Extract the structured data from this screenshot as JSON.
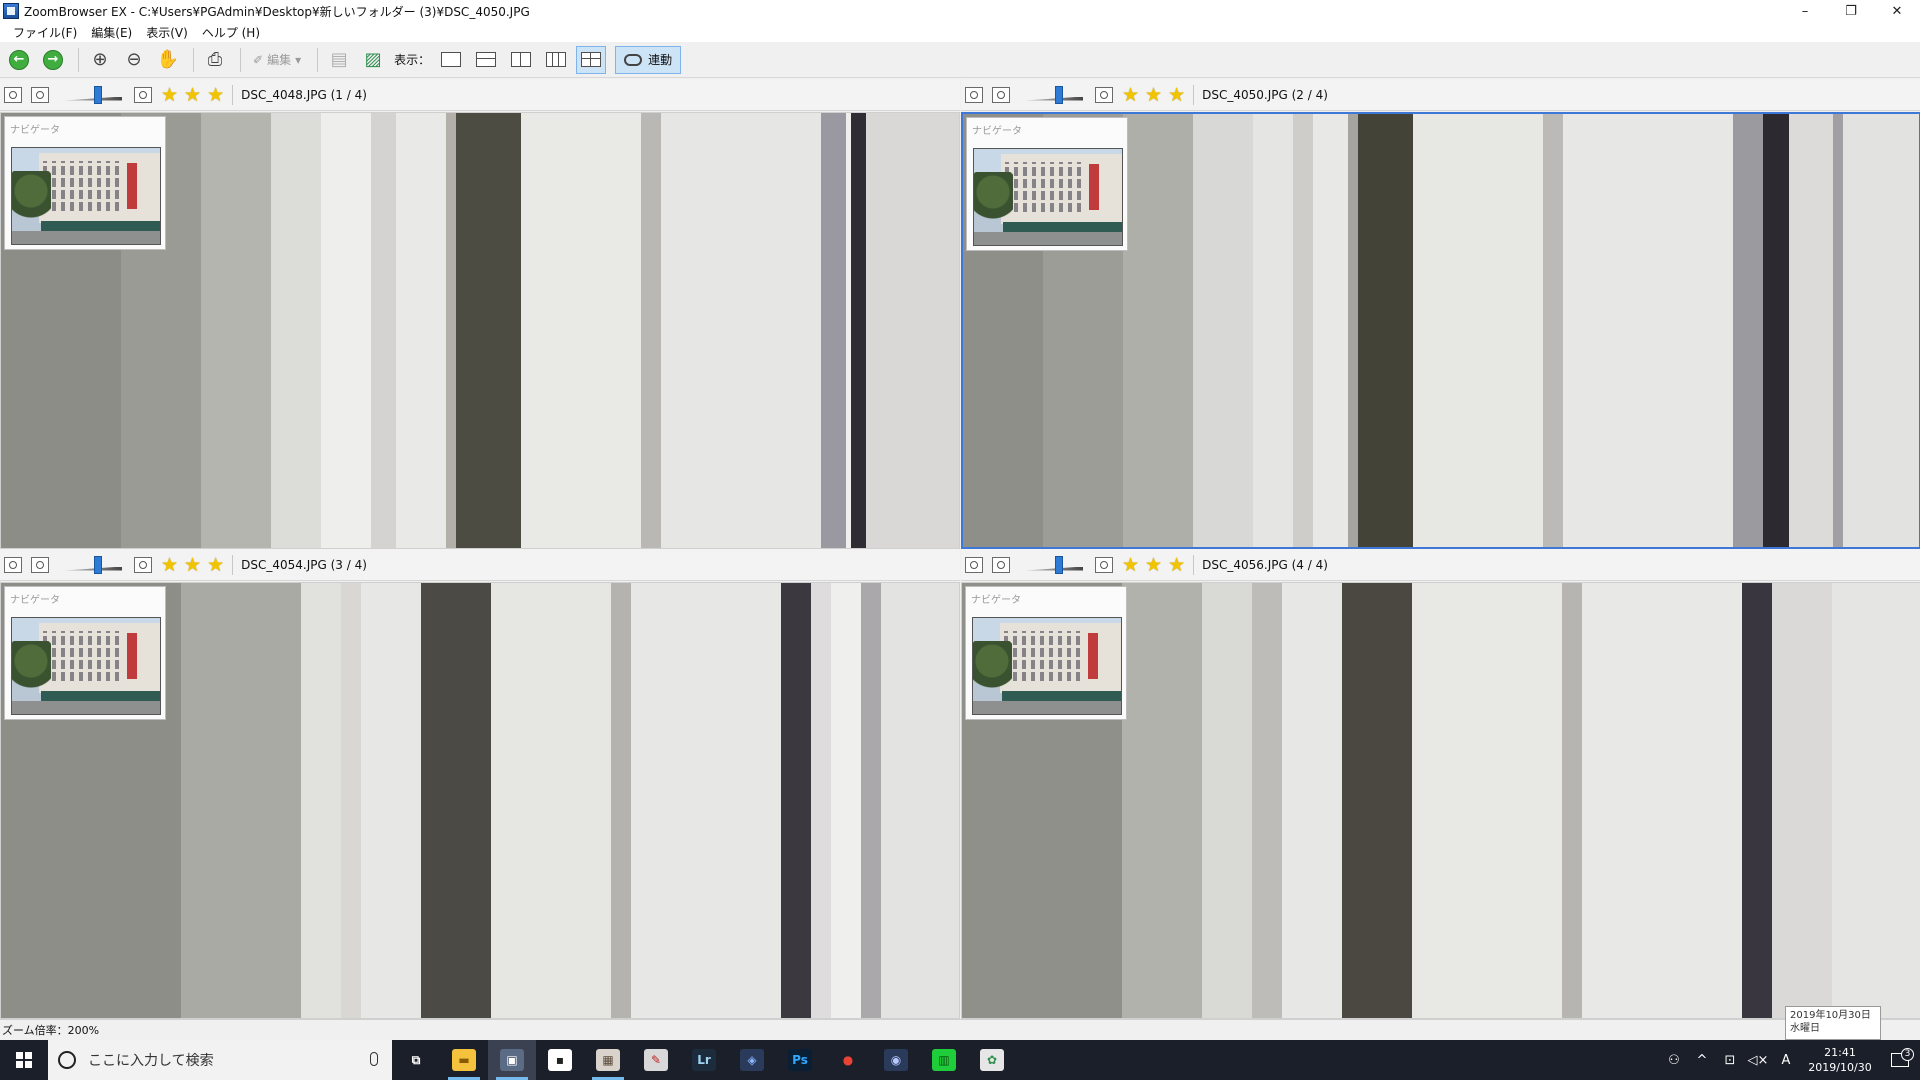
{
  "window": {
    "title": "ZoomBrowser EX - C:¥Users¥PGAdmin¥Desktop¥新しいフォルダー (3)¥DSC_4050.JPG",
    "controls": {
      "minimize": "–",
      "restore": "❐",
      "close": "✕"
    }
  },
  "menu": {
    "items": [
      "ファイル(F)",
      "編集(E)",
      "表示(V)",
      "ヘルプ (H)"
    ]
  },
  "toolbar": {
    "edit_label": "編集",
    "view_label": "表示：",
    "sync_label": "連動",
    "icons": [
      "back-arrow-icon",
      "forward-arrow-icon",
      "zoom-in-icon",
      "zoom-out-icon",
      "hand-icon",
      "print-icon"
    ]
  },
  "panels": [
    {
      "filename": "DSC_4048.JPG (1 / 4)",
      "navigator_label": "ナビゲータ",
      "selected": false,
      "zoom_level": 0.6
    },
    {
      "filename": "DSC_4050.JPG (2 / 4)",
      "navigator_label": "ナビゲータ",
      "selected": true,
      "zoom_level": 0.6
    },
    {
      "filename": "DSC_4054.JPG (3 / 4)",
      "navigator_label": "ナビゲータ",
      "selected": false,
      "zoom_level": 0.6
    },
    {
      "filename": "DSC_4056.JPG (4 / 4)",
      "navigator_label": "ナビゲータ",
      "selected": false,
      "zoom_level": 0.6
    }
  ],
  "status": {
    "zoom_text": "ズーム倍率：200%"
  },
  "tooltip": {
    "date": "2019年10月30日",
    "weekday": "水曜日"
  },
  "taskbar": {
    "search_placeholder": "ここに入力して検索",
    "apps": [
      {
        "name": "task-view",
        "label": "⧉",
        "bg": "transparent",
        "fg": "#ffffff"
      },
      {
        "name": "file-explorer",
        "label": "▬",
        "bg": "#f4c23d",
        "fg": "#8a5b00"
      },
      {
        "name": "zoombrowser",
        "label": "▣",
        "bg": "#5a6b86",
        "fg": "#ffffff"
      },
      {
        "name": "store",
        "label": "▪",
        "bg": "#ffffff",
        "fg": "#222222"
      },
      {
        "name": "image-viewer",
        "label": "▦",
        "bg": "#d9d3cc",
        "fg": "#5a4a3a"
      },
      {
        "name": "pdf-reader",
        "label": "✎",
        "bg": "#d8d8d8",
        "fg": "#c02020"
      },
      {
        "name": "lightroom",
        "label": "Lr",
        "bg": "#1c2c3c",
        "fg": "#9fd3f2"
      },
      {
        "name": "camera-tool",
        "label": "◈",
        "bg": "#2a3a5a",
        "fg": "#8ab4ff"
      },
      {
        "name": "photoshop",
        "label": "Ps",
        "bg": "#0a1f33",
        "fg": "#31a8ff"
      },
      {
        "name": "chrome",
        "label": "●",
        "bg": "transparent",
        "fg": "#e84335"
      },
      {
        "name": "capture-tool",
        "label": "◉",
        "bg": "#2a3a5a",
        "fg": "#b8c8ff"
      },
      {
        "name": "green-app",
        "label": "▥",
        "bg": "#1fcc3a",
        "fg": "#0a5a10"
      },
      {
        "name": "palette-app",
        "label": "✿",
        "bg": "#e6e6e6",
        "fg": "#2f8f4f"
      }
    ],
    "clock_time": "21:41",
    "clock_date": "2019/10/30",
    "ime": "A",
    "notification_count": "3"
  }
}
